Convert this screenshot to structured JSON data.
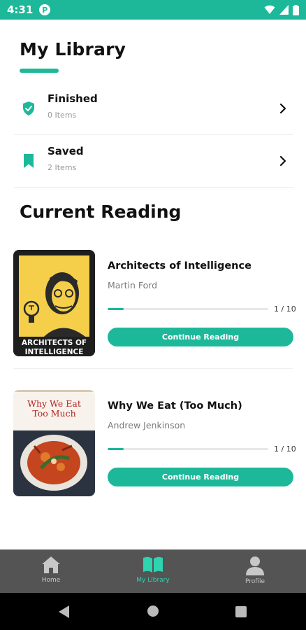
{
  "status_bar": {
    "time": "4:31",
    "app_badge": "P"
  },
  "header": {
    "title": "My Library"
  },
  "library": [
    {
      "label": "Finished",
      "count": "0 Items",
      "icon": "shield-check-icon"
    },
    {
      "label": "Saved",
      "count": "2 Items",
      "icon": "bookmark-icon"
    }
  ],
  "current_reading": {
    "title": "Current Reading",
    "books": [
      {
        "title": "Architects of Intelligence",
        "author": "Martin Ford",
        "progress_text": "1 / 10",
        "progress": 0.1,
        "button": "Continue Reading",
        "cover_text": "ARCHITECTS OF INTELLIGENCE"
      },
      {
        "title": "Why We Eat (Too Much)",
        "author": "Andrew Jenkinson",
        "progress_text": "1 / 10",
        "progress": 0.1,
        "button": "Continue Reading",
        "cover_text": "Why We Eat Too Much"
      }
    ]
  },
  "bottom_nav": [
    {
      "label": "Home",
      "icon": "home-icon",
      "active": false
    },
    {
      "label": "My Library",
      "icon": "book-open-icon",
      "active": true
    },
    {
      "label": "Profile",
      "icon": "person-icon",
      "active": false
    }
  ],
  "colors": {
    "accent": "#1db89a",
    "nav_bg": "#545454",
    "active_tab": "#2fd3b0"
  }
}
